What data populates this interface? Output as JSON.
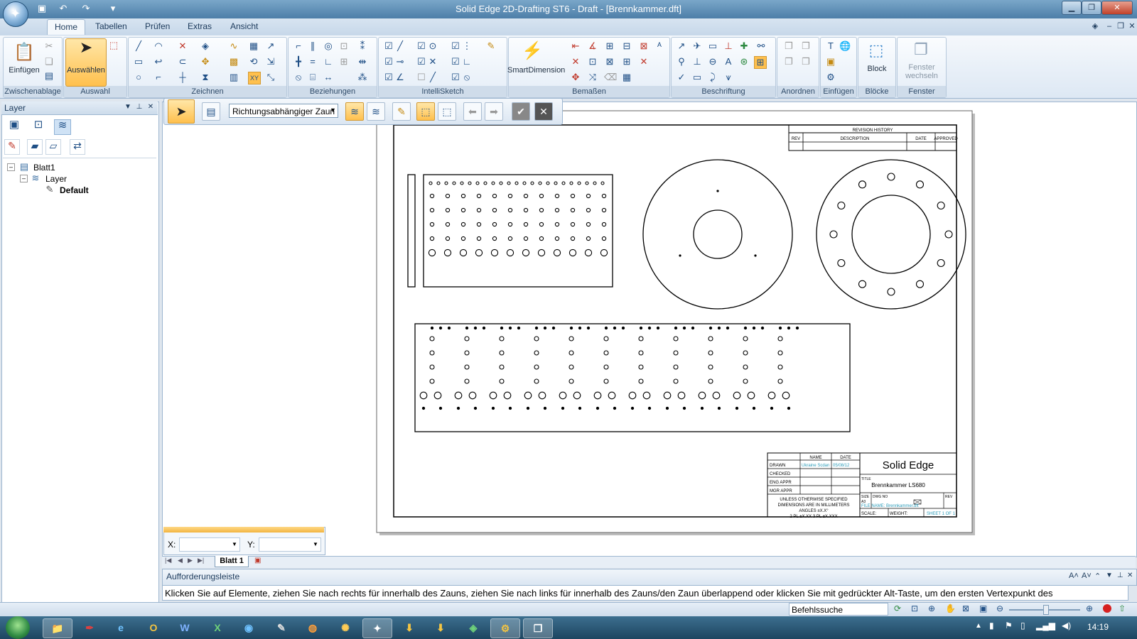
{
  "window": {
    "title": "Solid Edge 2D-Drafting ST6 - Draft - [Brennkammer.dft]"
  },
  "tabs": [
    "Home",
    "Tabellen",
    "Prüfen",
    "Extras",
    "Ansicht"
  ],
  "ribbon": {
    "einfuegen_label": "Einfügen",
    "auswaehlen_label": "Auswählen",
    "smartdimension_label": "SmartDimension",
    "block_label": "Block",
    "fenster_wechseln_label": "Fenster\nwechseln",
    "groups": [
      "Zwischenablage",
      "Auswahl",
      "Zeichnen",
      "Beziehungen",
      "IntelliSketch",
      "Bemaßen",
      "Beschriftung",
      "Anordnen",
      "Einfügen",
      "Blöcke",
      "Fenster"
    ]
  },
  "layer_panel": {
    "title": "Layer",
    "tree": {
      "sheet": "Blatt1",
      "layer_group": "Layer",
      "layer_default": "Default"
    }
  },
  "command_bar": {
    "fence_option": "Richtungsabhängiger Zaun"
  },
  "coords": {
    "x_label": "X:",
    "y_label": "Y:"
  },
  "sheet_tab": "Blatt 1",
  "prompt": {
    "title": "Aufforderungsleiste",
    "text": "Klicken Sie auf Elemente, ziehen Sie nach rechts für innerhalb des Zauns, ziehen Sie nach links für innerhalb des Zauns/den Zaun überlappend oder klicken Sie mit gedrückter Alt-Taste, um den ersten Vertexpunkt des"
  },
  "status": {
    "command_search": "Befehlssuche"
  },
  "drawing": {
    "revision_history": "REVISION HISTORY",
    "rev_cols": [
      "REV",
      "DESCRIPTION",
      "DATE",
      "APPROVED"
    ],
    "tb_name": "NAME",
    "tb_date": "DATE",
    "tb_rows": [
      "DRAWN",
      "CHECKED",
      "ENG APPR",
      "MGR APPR"
    ],
    "drawn_name": "Ukraine Scdan",
    "drawn_date": "05/08/12",
    "company": "Solid Edge",
    "title_label": "TITLE",
    "title_value": "Brennkammer LS680",
    "tolerance_note": [
      "UNLESS OTHERWISE SPECIFIED",
      "DIMENSIONS ARE IN MILLIMETERS",
      "ANGLES ±X.X°",
      "2 PL ±X.XX 3 PL ±X.XXX"
    ],
    "size_label": "SIZE",
    "size_value": "A3",
    "dwg_label": "DWG NO",
    "rev_label": "REV",
    "file_name": "FILE NAME: Brennkammer.dft",
    "scale_label": "SCALE:",
    "weight_label": "WEIGHT:",
    "sheet_label": "SHEET 1 OF 1"
  },
  "taskbar": {
    "clock": "14:19",
    "apps": [
      "O",
      "W",
      "X"
    ]
  },
  "colors": {
    "selected": "#ffc04d",
    "cyan_text": "#2a9bb8"
  }
}
